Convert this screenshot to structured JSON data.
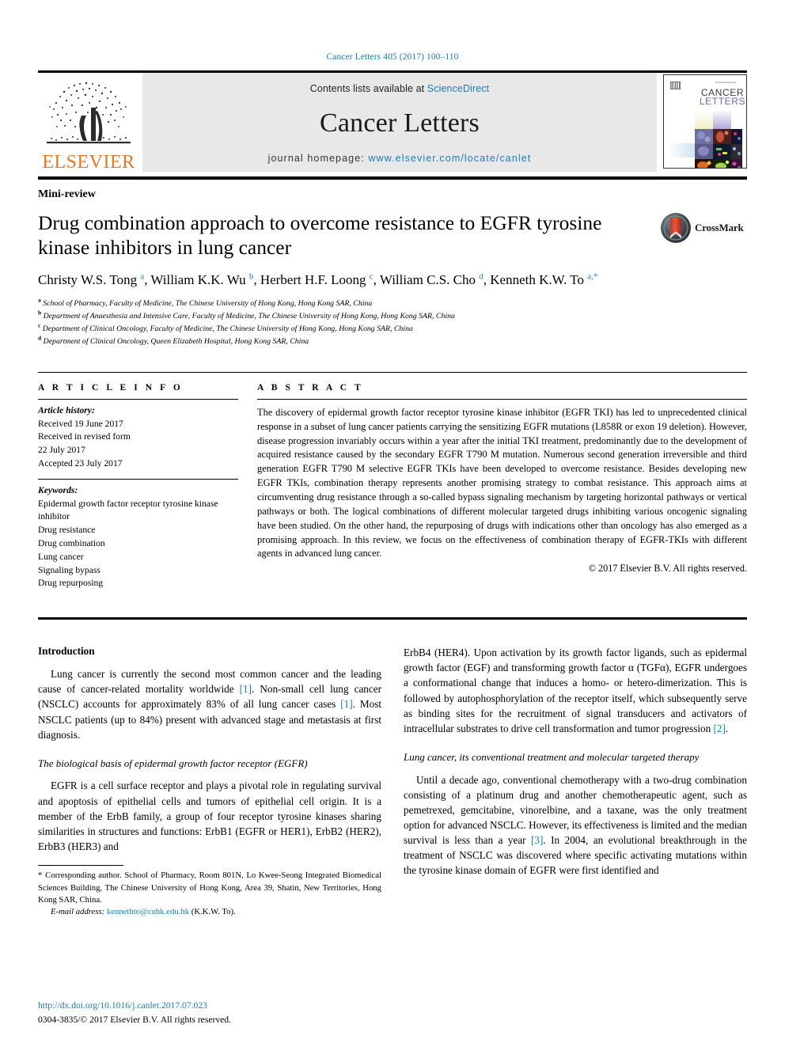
{
  "running_head": "Cancer Letters 405 (2017) 100–110",
  "masthead": {
    "publisher_name": "ELSEVIER",
    "contents_prefix": "Contents lists available at ",
    "contents_link": "ScienceDirect",
    "journal_title": "Cancer Letters",
    "homepage_prefix": "journal homepage: ",
    "homepage_url": "www.elsevier.com/locate/canlet",
    "cover_title_line1": "CANCER",
    "cover_title_line2": "LETTERS"
  },
  "article": {
    "kicker": "Mini-review",
    "title": "Drug combination approach to overcome resistance to EGFR tyrosine kinase inhibitors in lung cancer",
    "authors_html": "Christy W.S. Tong <sup>a</sup>, William K.K. Wu <sup>b</sup>, Herbert H.F. Loong <sup>c</sup>, William C.S. Cho <sup>d</sup>, Kenneth K.W. To <sup>a,&#42;</sup>",
    "crossmark_label": "CrossMark",
    "affiliations": [
      {
        "marker": "a",
        "text": "School of Pharmacy, Faculty of Medicine, The Chinese University of Hong Kong, Hong Kong SAR, China"
      },
      {
        "marker": "b",
        "text": "Department of Anaesthesia and Intensive Care, Faculty of Medicine, The Chinese University of Hong Kong, Hong Kong SAR, China"
      },
      {
        "marker": "c",
        "text": "Department of Clinical Oncology, Faculty of Medicine, The Chinese University of Hong Kong, Hong Kong SAR, China"
      },
      {
        "marker": "d",
        "text": "Department of Clinical Oncology, Queen Elizabeth Hospital, Hong Kong SAR, China"
      }
    ]
  },
  "article_info": {
    "label": "A R T I C L E   I N F O",
    "history_label": "Article history:",
    "history_lines": [
      "Received 19 June 2017",
      "Received in revised form",
      "22 July 2017",
      "Accepted 23 July 2017"
    ],
    "keywords_label": "Keywords:",
    "keywords": [
      "Epidermal growth factor receptor tyrosine kinase inhibitor",
      "Drug resistance",
      "Drug combination",
      "Lung cancer",
      "Signaling bypass",
      "Drug repurposing"
    ]
  },
  "abstract": {
    "label": "A B S T R A C T",
    "text": "The discovery of epidermal growth factor receptor tyrosine kinase inhibitor (EGFR TKI) has led to unprecedented clinical response in a subset of lung cancer patients carrying the sensitizing EGFR mutations (L858R or exon 19 deletion). However, disease progression invariably occurs within a year after the initial TKI treatment, predominantly due to the development of acquired resistance caused by the secondary EGFR T790 M mutation. Numerous second generation irreversible and third generation EGFR T790 M selective EGFR TKIs have been developed to overcome resistance. Besides developing new EGFR TKIs, combination therapy represents another promising strategy to combat resistance. This approach aims at circumventing drug resistance through a so-called bypass signaling mechanism by targeting horizontal pathways or vertical pathways or both. The logical combinations of different molecular targeted drugs inhibiting various oncogenic signaling have been studied. On the other hand, the repurposing of drugs with indications other than oncology has also emerged as a promising approach. In this review, we focus on the effectiveness of combination therapy of EGFR-TKIs with different agents in advanced lung cancer.",
    "copyright": "© 2017 Elsevier B.V. All rights reserved."
  },
  "body": {
    "left": {
      "intro_heading": "Introduction",
      "intro_p1_a": "Lung cancer is currently the second most common cancer and the leading cause of cancer-related mortality worldwide ",
      "intro_p1_ref1": "[1]",
      "intro_p1_b": ". Non-small cell lung cancer (NSCLC) accounts for approximately 83% of all lung cancer cases ",
      "intro_p1_ref2": "[1]",
      "intro_p1_c": ". Most NSCLC patients (up to 84%) present with advanced stage and metastasis at first diagnosis.",
      "subhead": "The biological basis of epidermal growth factor receptor (EGFR)",
      "p2": "EGFR is a cell surface receptor and plays a pivotal role in regulating survival and apoptosis of epithelial cells and tumors of epithelial cell origin. It is a member of the ErbB family, a group of four receptor tyrosine kinases sharing similarities in structures and functions: ErbB1 (EGFR or HER1), ErbB2 (HER2), ErbB3 (HER3) and",
      "footnote_star": "*",
      "footnote_text": " Corresponding author. School of Pharmacy, Room 801N, Lo Kwee-Seong Integrated Biomedical Sciences Building, The Chinese University of Hong Kong, Area 39, Shatin, New Territories, Hong Kong SAR, China.",
      "footnote_email_label": "E-mail address:",
      "footnote_email": "kennethto@cuhk.edu.hk",
      "footnote_email_suffix": " (K.K.W. To)."
    },
    "right": {
      "p1_a": "ErbB4 (HER4). Upon activation by its growth factor ligands, such as epidermal growth factor (EGF) and transforming growth factor α (TGFα), EGFR undergoes a conformational change that induces a homo- or hetero-dimerization. This is followed by autophosphorylation of the receptor itself, which subsequently serve as binding sites for the recruitment of signal transducers and activators of intracellular substrates to drive cell transformation and tumor progression ",
      "p1_ref": "[2]",
      "p1_b": ".",
      "subhead": "Lung cancer, its conventional treatment and molecular targeted therapy",
      "p2_a": "Until a decade ago, conventional chemotherapy with a two-drug combination consisting of a platinum drug and another chemotherapeutic agent, such as pemetrexed, gemcitabine, vinorelbine, and a taxane, was the only treatment option for advanced NSCLC. However, its effectiveness is limited and the median survival is less than a year ",
      "p2_ref": "[3]",
      "p2_b": ". In 2004, an evolutional breakthrough in the treatment of NSCLC was discovered where specific activating mutations within the tyrosine kinase domain of EGFR were first identified and"
    }
  },
  "publication_footer": {
    "doi": "http://dx.doi.org/10.1016/j.canlet.2017.07.023",
    "issn_line": "0304-3835/© 2017 Elsevier B.V. All rights reserved."
  },
  "colors": {
    "link": "#1a7db6",
    "elsevier_orange": "#e87722",
    "masthead_gray": "#e8e8e8"
  }
}
